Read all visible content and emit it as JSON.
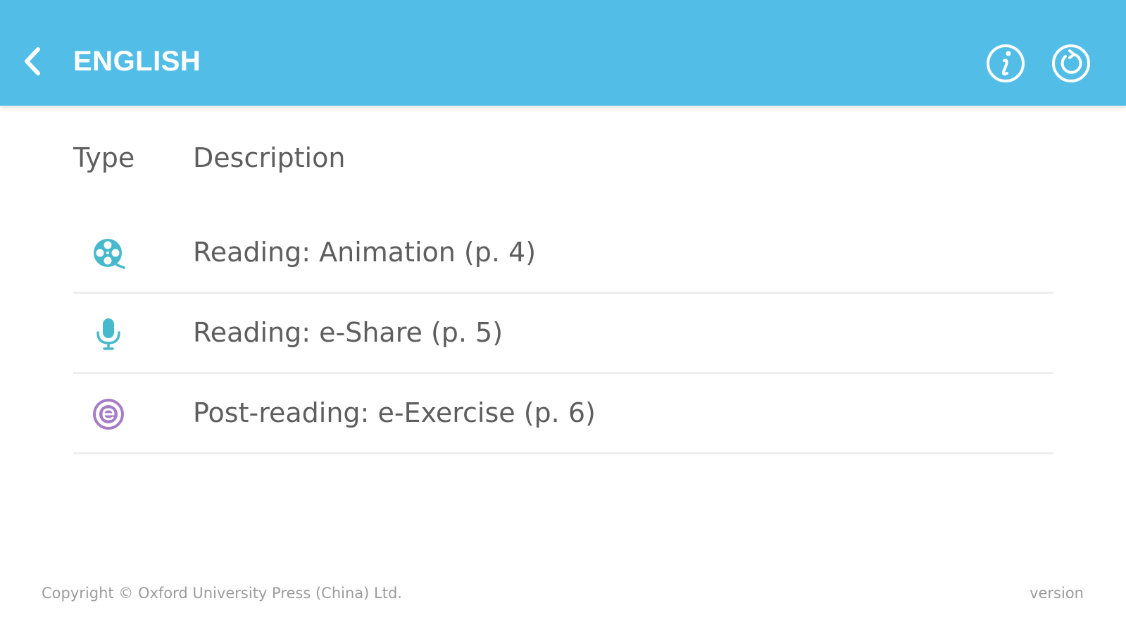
{
  "header": {
    "title": "ENGLISH",
    "back_icon": "chevron-left-icon",
    "info_icon": "info-icon",
    "refresh_icon": "refresh-icon",
    "background_color": "#52bee7"
  },
  "table": {
    "columns": [
      "Type",
      "Description"
    ],
    "rows": [
      {
        "icon": "film-reel-icon",
        "icon_color": "#46b9cc",
        "description": "Reading: Animation (p. 4)"
      },
      {
        "icon": "microphone-icon",
        "icon_color": "#46b9cc",
        "description": "Reading: e-Share (p. 5)"
      },
      {
        "icon": "e-exercise-icon",
        "icon_color": "#a77cc7",
        "description": "Post-reading: e-Exercise (p. 6)"
      }
    ]
  },
  "footer": {
    "copyright": "Copyright © Oxford University Press (China) Ltd.",
    "version": "version"
  }
}
